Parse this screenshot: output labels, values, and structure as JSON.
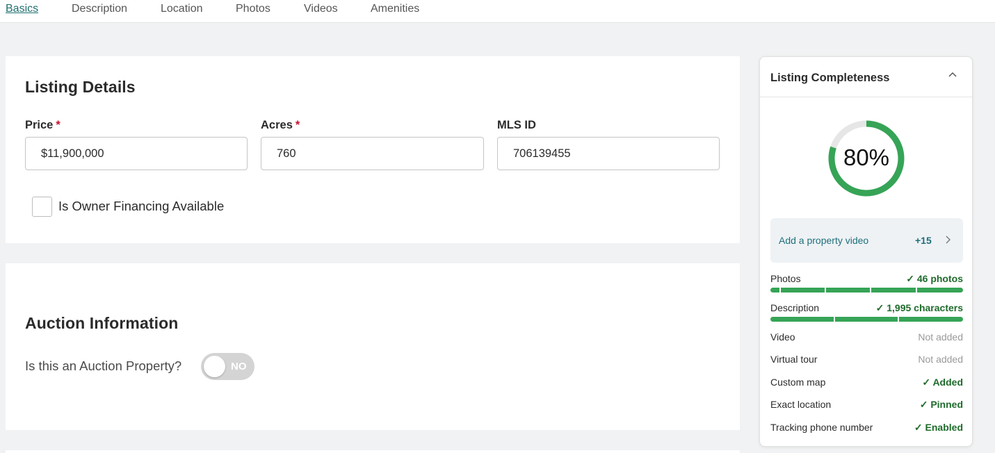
{
  "tabs": [
    {
      "label": "Basics",
      "active": true
    },
    {
      "label": "Description"
    },
    {
      "label": "Location"
    },
    {
      "label": "Photos"
    },
    {
      "label": "Videos"
    },
    {
      "label": "Amenities"
    }
  ],
  "listing_details": {
    "title": "Listing Details",
    "price": {
      "label": "Price",
      "required_mark": "*",
      "value": "$11,900,000"
    },
    "acres": {
      "label": "Acres",
      "required_mark": "*",
      "value": "760"
    },
    "mls": {
      "label": "MLS ID",
      "value": "706139455"
    },
    "owner_financing": {
      "label": "Is Owner Financing Available",
      "checked": false
    }
  },
  "auction": {
    "title": "Auction Information",
    "question": "Is this an Auction Property?",
    "toggle_label": "NO",
    "toggle_on": false
  },
  "completeness": {
    "title": "Listing Completeness",
    "percent": 80,
    "percent_text": "80%",
    "suggestion": {
      "text": "Add a property video",
      "points": "+15"
    },
    "rows": [
      {
        "label": "Photos",
        "status": "✓ 46 photos",
        "state": "ok",
        "bar": 1.0
      },
      {
        "label": "Description",
        "status": "✓ 1,995 characters",
        "state": "ok",
        "bar": 1.0
      },
      {
        "label": "Video",
        "status": "Not added",
        "state": "no"
      },
      {
        "label": "Virtual tour",
        "status": "Not added",
        "state": "no"
      },
      {
        "label": "Custom map",
        "status": "✓ Added",
        "state": "ok"
      },
      {
        "label": "Exact location",
        "status": "✓ Pinned",
        "state": "ok"
      },
      {
        "label": "Tracking phone number",
        "status": "✓ Enabled",
        "state": "ok"
      }
    ]
  },
  "colors": {
    "accent": "#1f6f6f",
    "progress": "#36a456",
    "required": "#c8102e"
  }
}
